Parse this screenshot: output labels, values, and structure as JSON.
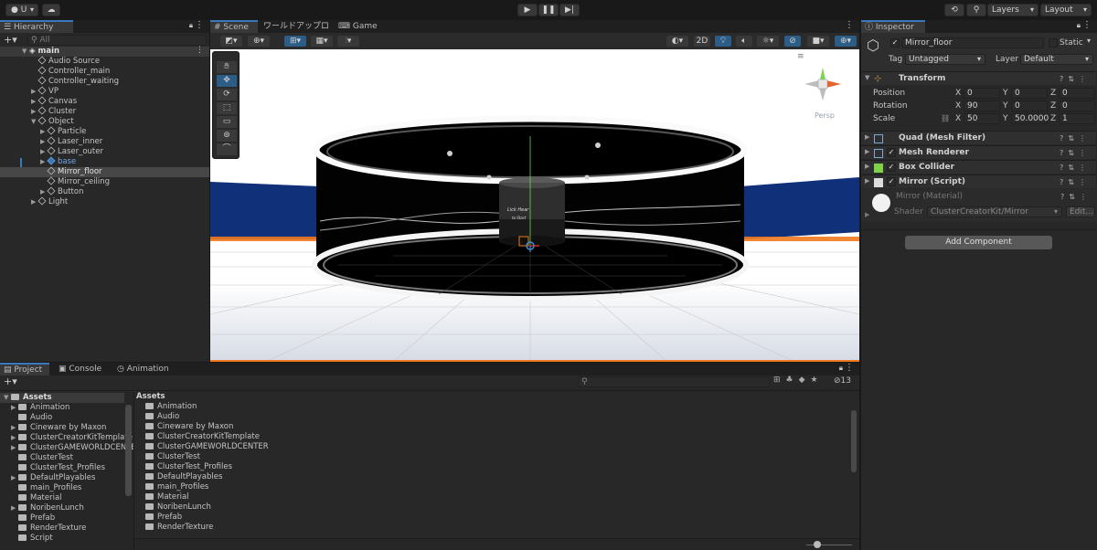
{
  "toolbar": {
    "account_label": "U",
    "layers_label": "Layers",
    "layout_label": "Layout"
  },
  "hierarchy": {
    "tab_label": "Hierarchy",
    "search_placeholder": "All",
    "scene_name": "main",
    "items": [
      {
        "label": "Audio Source"
      },
      {
        "label": "Controller_main"
      },
      {
        "label": "Controller_waiting"
      },
      {
        "label": "VP"
      },
      {
        "label": "Canvas"
      },
      {
        "label": "Cluster"
      },
      {
        "label": "Object"
      },
      {
        "label": "Particle"
      },
      {
        "label": "Laser_inner"
      },
      {
        "label": "Laser_outer"
      },
      {
        "label": "base"
      },
      {
        "label": "Mirror_floor"
      },
      {
        "label": "Mirror_ceiling"
      },
      {
        "label": "Button"
      },
      {
        "label": "Light"
      }
    ]
  },
  "scene": {
    "tabs": [
      {
        "label": "Scene"
      },
      {
        "label": "ワールドアップロード"
      },
      {
        "label": "Game"
      }
    ],
    "mode_2d": "2D",
    "persp_label": "Persp",
    "sign_line1": "Lick Hear",
    "sign_line2": "to Start"
  },
  "inspector": {
    "tab_label": "Inspector",
    "object_name": "Mirror_floor",
    "static_label": "Static",
    "tag_label": "Tag",
    "tag_value": "Untagged",
    "layer_label": "Layer",
    "layer_value": "Default",
    "transform": {
      "title": "Transform",
      "position_label": "Position",
      "rotation_label": "Rotation",
      "scale_label": "Scale",
      "axis_x": "X",
      "axis_y": "Y",
      "axis_z": "Z",
      "position": {
        "x": "0",
        "y": "0",
        "z": "0"
      },
      "rotation": {
        "x": "90",
        "y": "0",
        "z": "0"
      },
      "scale": {
        "x": "50",
        "y": "50.0000",
        "z": "1"
      }
    },
    "components": [
      {
        "title": "Quad (Mesh Filter)"
      },
      {
        "title": "Mesh Renderer"
      },
      {
        "title": "Box Collider"
      },
      {
        "title": "Mirror (Script)"
      }
    ],
    "material_name": "Mirror (Material)",
    "shader_label": "Shader",
    "shader_value": "ClusterCreatorKit/Mirror",
    "edit_label": "Edit...",
    "add_component_label": "Add Component"
  },
  "bottom": {
    "tabs": [
      {
        "label": "Project"
      },
      {
        "label": "Console"
      },
      {
        "label": "Animation"
      }
    ],
    "hidden_count": "13",
    "tree_root": "Assets",
    "tree": [
      {
        "label": "Animation"
      },
      {
        "label": "Audio"
      },
      {
        "label": "Cineware by Maxon"
      },
      {
        "label": "ClusterCreatorKitTemplate"
      },
      {
        "label": "ClusterGAMEWORLDCENTER"
      },
      {
        "label": "ClusterTest"
      },
      {
        "label": "ClusterTest_Profiles"
      },
      {
        "label": "DefaultPlayables"
      },
      {
        "label": "main_Profiles"
      },
      {
        "label": "Material"
      },
      {
        "label": "NoribenLunch"
      },
      {
        "label": "Prefab"
      },
      {
        "label": "RenderTexture"
      },
      {
        "label": "Script"
      }
    ],
    "breadcrumb": "Assets",
    "folders": [
      {
        "label": "Animation"
      },
      {
        "label": "Audio"
      },
      {
        "label": "Cineware by Maxon"
      },
      {
        "label": "ClusterCreatorKitTemplate"
      },
      {
        "label": "ClusterGAMEWORLDCENTER"
      },
      {
        "label": "ClusterTest"
      },
      {
        "label": "ClusterTest_Profiles"
      },
      {
        "label": "DefaultPlayables"
      },
      {
        "label": "main_Profiles"
      },
      {
        "label": "Material"
      },
      {
        "label": "NoribenLunch"
      },
      {
        "label": "Prefab"
      },
      {
        "label": "RenderTexture"
      }
    ]
  },
  "colors": {
    "accent": "#3a79bb",
    "selection": "#2c5d87",
    "sky_blue": "#10317a",
    "orange_outline": "#f07a1f"
  }
}
